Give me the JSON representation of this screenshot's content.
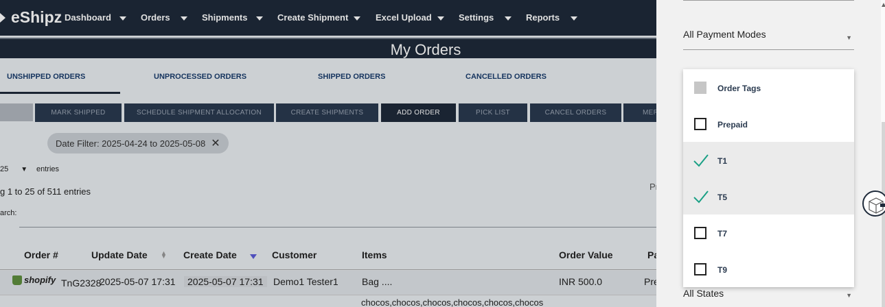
{
  "brand": {
    "name": "eShipz"
  },
  "nav": {
    "items": [
      {
        "label": "Dashboard"
      },
      {
        "label": "Orders"
      },
      {
        "label": "Shipments"
      },
      {
        "label": "Create Shipment"
      },
      {
        "label": "Excel Upload"
      },
      {
        "label": "Settings"
      },
      {
        "label": "Reports"
      }
    ]
  },
  "page": {
    "title": "My Orders"
  },
  "tabs": [
    {
      "label": "UNSHIPPED ORDERS",
      "active": true
    },
    {
      "label": "UNPROCESSED ORDERS"
    },
    {
      "label": "SHIPPED ORDERS"
    },
    {
      "label": "CANCELLED ORDERS"
    }
  ],
  "toolbar": {
    "buttons": [
      {
        "label": "MARK SHIPPED"
      },
      {
        "label": "SCHEDULE SHIPMENT ALLOCATION"
      },
      {
        "label": "CREATE SHIPMENTS"
      },
      {
        "label": "ADD ORDER"
      },
      {
        "label": "PICK LIST"
      },
      {
        "label": "CANCEL ORDERS"
      },
      {
        "label": "MER"
      }
    ]
  },
  "filter_chip": {
    "label": "Date Filter: 2025-04-24 to 2025-05-08",
    "close": "✕"
  },
  "table_controls": {
    "page_size": "25",
    "entries_label": "entries",
    "showing_text": "g 1 to 25 of 511 entries",
    "search_label": "arch:",
    "pager_partial": "Pr"
  },
  "table": {
    "headers": [
      "Order #",
      "Update Date",
      "Create Date",
      "Customer",
      "Items",
      "Order Value",
      "Pa"
    ],
    "rows": [
      {
        "channel": "shopify",
        "order": "TnG2328",
        "update_date": "2025-05-07 17:31",
        "create_date": "2025-05-07 17:31",
        "customer": "Demo1 Tester1",
        "items": "Bag ....",
        "value": "INR 500.0",
        "payment": "Pre"
      }
    ],
    "next_row_items": "chocos,chocos,chocos,chocos,chocos,chocos"
  },
  "drawer": {
    "payment_mode": "All Payment Modes",
    "state_select": "All States",
    "tag_options": [
      {
        "label": "Order Tags",
        "state": "disabled"
      },
      {
        "label": "Prepaid",
        "state": "unchecked"
      },
      {
        "label": "T1",
        "state": "checked"
      },
      {
        "label": "T5",
        "state": "checked"
      },
      {
        "label": "T7",
        "state": "unchecked"
      },
      {
        "label": "T9",
        "state": "unchecked"
      }
    ]
  },
  "colors": {
    "nav_bg": "#1e2a3a",
    "check_green": "#1aa085",
    "tab_text": "#1a3d6d"
  }
}
